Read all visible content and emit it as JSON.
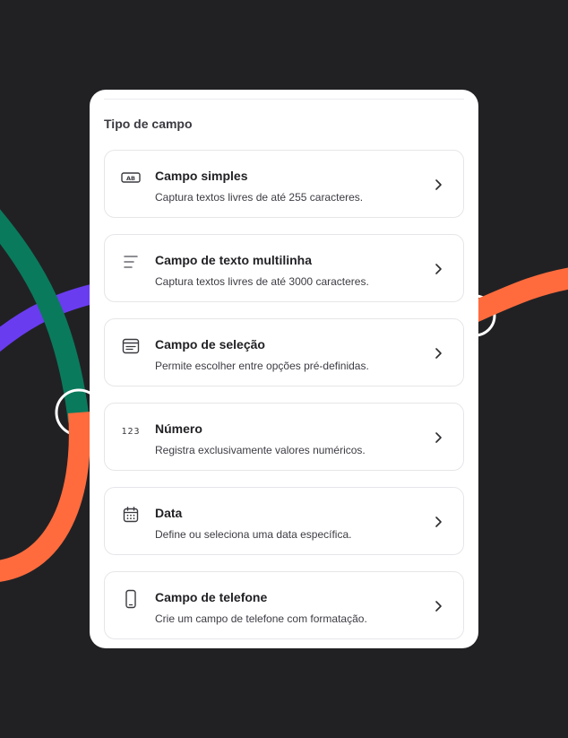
{
  "panel": {
    "title": "Tipo de campo"
  },
  "options": [
    {
      "icon": "text-field-icon",
      "title": "Campo simples",
      "description": "Captura textos livres de até 255 caracteres."
    },
    {
      "icon": "multiline-text-icon",
      "title": "Campo de texto multilinha",
      "description": "Captura textos livres de até 3000 caracteres."
    },
    {
      "icon": "select-field-icon",
      "title": "Campo de seleção",
      "description": "Permite escolher entre opções pré-definidas."
    },
    {
      "icon": "number-icon",
      "title": "Número",
      "description": "Registra exclusivamente valores numéricos."
    },
    {
      "icon": "calendar-icon",
      "title": "Data",
      "description": "Define ou seleciona uma data específica."
    },
    {
      "icon": "phone-icon",
      "title": "Campo de telefone",
      "description": "Crie um campo de telefone com formatação."
    }
  ],
  "icon_glyphs": {
    "text_field": "AB",
    "number": "123"
  },
  "colors": {
    "background": "#212124",
    "panel": "#ffffff",
    "green_ribbon": "#0a7a5c",
    "orange_ribbon": "#ff6b3d",
    "purple_ribbon": "#6a3cf0"
  }
}
